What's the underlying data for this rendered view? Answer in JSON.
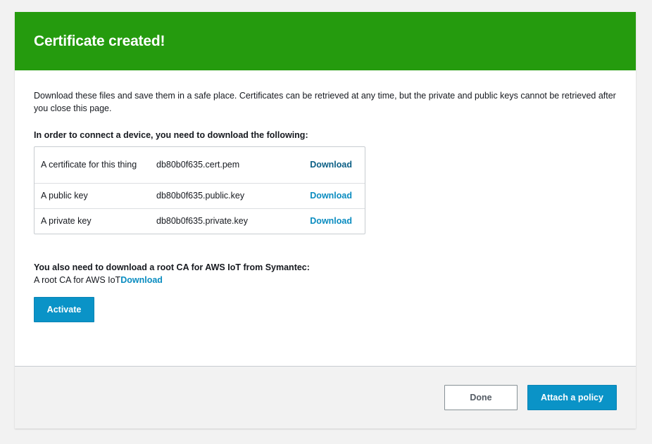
{
  "header": {
    "title": "Certificate created!"
  },
  "body": {
    "intro": "Download these files and save them in a safe place. Certificates can be retrieved at any time, but the private and public keys cannot be retrieved after you close this page.",
    "files_heading": "In order to connect a device, you need to download the following:",
    "files": [
      {
        "description": "A certificate for this thing",
        "filename": "db80b0f635.cert.pem",
        "action": "Download",
        "visited": true
      },
      {
        "description": "A public key",
        "filename": "db80b0f635.public.key",
        "action": "Download",
        "visited": false
      },
      {
        "description": "A private key",
        "filename": "db80b0f635.private.key",
        "action": "Download",
        "visited": false
      }
    ],
    "root_ca_heading": "You also need to download a root CA for AWS IoT from Symantec:",
    "root_ca_label": "A root CA for AWS IoT",
    "root_ca_link": "Download",
    "activate_label": "Activate"
  },
  "footer": {
    "done_label": "Done",
    "attach_label": "Attach a policy"
  },
  "colors": {
    "header_bg": "#259b0e",
    "primary": "#0a93c7",
    "link": "#0a8cc0",
    "link_visited": "#0b5f85"
  }
}
